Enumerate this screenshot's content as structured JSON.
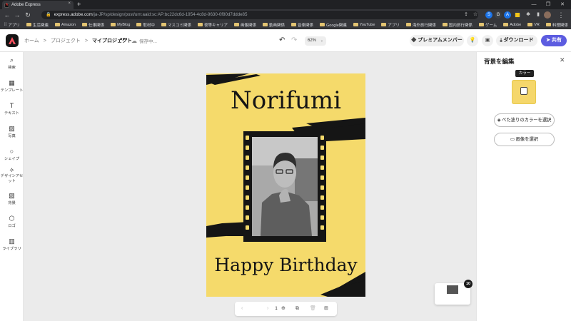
{
  "browser": {
    "tab_title": "Adobe Express",
    "tab_close": "×",
    "new_tab": "+",
    "url_domain": "express.adobe.com",
    "url_path": "/ja-JP/sp/design/post/urn:aaid:sc:AP:bc22dc6d-1954-4c8d-9630-0f80d7ddde85",
    "extensions": [
      "S",
      "G",
      "A"
    ],
    "bookmarks": [
      "アプリ",
      "生活関連",
      "Amazon",
      "仕事関係",
      "MyBlog",
      "取材中",
      "マスコミ関係",
      "夜等キャリア",
      "画像関係",
      "動画関係",
      "音楽関係",
      "Google関連",
      "YouTube",
      "アプリ",
      "海外旅行関係",
      "国内旅行関係",
      "ゲーム",
      "Adobe",
      "VR",
      "料理関係",
      "AI"
    ]
  },
  "header": {
    "breadcrumb": [
      "ホーム",
      "プロジェクト",
      "マイプロジェクト"
    ],
    "breadcrumb_sep": ">",
    "more": "•••",
    "save_status": "保存中...",
    "zoom": "62%",
    "premium_label": "プレミアムメンバー",
    "download_label": "ダウンロード",
    "share_label": "共有"
  },
  "leftrail": [
    {
      "label": "検索",
      "icon": "search-icon"
    },
    {
      "label": "テンプレート",
      "icon": "template-icon"
    },
    {
      "label": "テキスト",
      "icon": "text-icon"
    },
    {
      "label": "写真",
      "icon": "photo-icon"
    },
    {
      "label": "シェイプ",
      "icon": "shape-icon"
    },
    {
      "label": "デザインアセット",
      "icon": "design-asset-icon"
    },
    {
      "label": "背景",
      "icon": "background-icon"
    },
    {
      "label": "ロゴ",
      "icon": "logo-icon"
    },
    {
      "label": "ライブラリ",
      "icon": "library-icon"
    }
  ],
  "canvas": {
    "poster_name": "Norifumi",
    "poster_greeting": "Happy Birthday",
    "poster_bg": "#f5da6b",
    "page_number": "1",
    "page_count_badge": "10"
  },
  "panel": {
    "title": "背景を編集",
    "tooltip": "カラー",
    "fill_button": "べた塗りのカラーを選択",
    "image_button": "画像を選択",
    "swatch_color": "#f5d76b"
  },
  "accent": "#5c5ce0"
}
